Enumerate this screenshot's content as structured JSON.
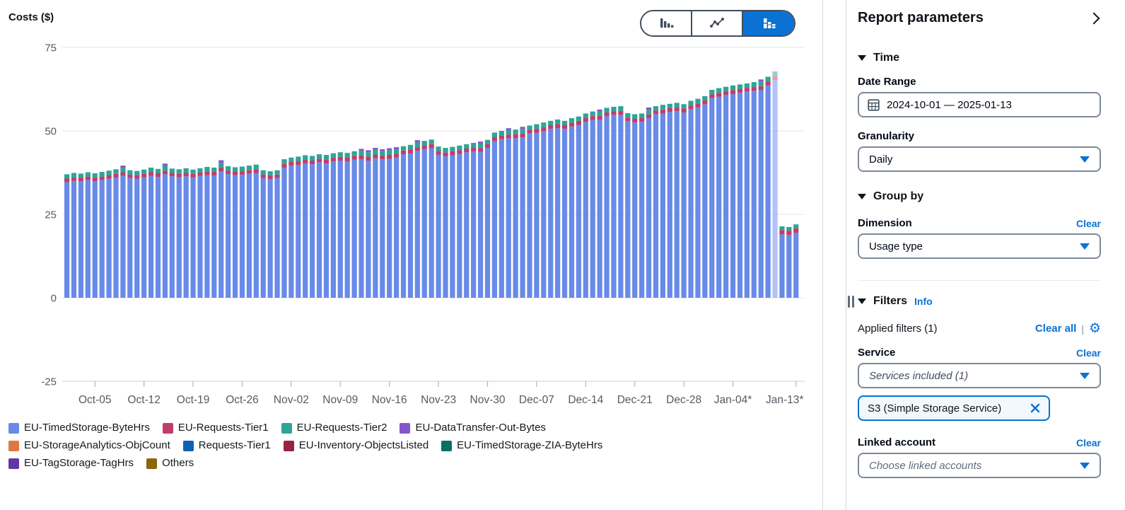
{
  "chart": {
    "title": "Costs ($)",
    "toggle_options": [
      {
        "name": "bar-chart",
        "selected": false
      },
      {
        "name": "line-chart",
        "selected": false
      },
      {
        "name": "stacked-bar-chart",
        "selected": true
      }
    ]
  },
  "legend": {
    "items": [
      {
        "label": "EU-TimedStorage-ByteHrs",
        "color": "#688AE8"
      },
      {
        "label": "EU-Requests-Tier1",
        "color": "#C33D69"
      },
      {
        "label": "EU-Requests-Tier2",
        "color": "#2EA597"
      },
      {
        "label": "EU-DataTransfer-Out-Bytes",
        "color": "#8456CE"
      },
      {
        "label": "EU-StorageAnalytics-ObjCount",
        "color": "#E07941"
      },
      {
        "label": "Requests-Tier1",
        "color": "#0D63B0"
      },
      {
        "label": "EU-Inventory-ObjectsListed",
        "color": "#962249"
      },
      {
        "label": "EU-TimedStorage-ZIA-ByteHrs",
        "color": "#096F64"
      },
      {
        "label": "EU-TagStorage-TagHrs",
        "color": "#6237A7"
      },
      {
        "label": "Others",
        "color": "#8D6605"
      }
    ]
  },
  "chart_data": {
    "type": "bar",
    "stacked": true,
    "title": "Costs ($)",
    "ylabel": "Costs ($)",
    "ylim": [
      -25,
      75
    ],
    "yticks": [
      75,
      50,
      25,
      0,
      -25
    ],
    "grid": true,
    "legend_position": "bottom",
    "xticks": [
      {
        "label": "Oct-05",
        "day": 4
      },
      {
        "label": "Oct-12",
        "day": 11
      },
      {
        "label": "Oct-19",
        "day": 18
      },
      {
        "label": "Oct-26",
        "day": 25
      },
      {
        "label": "Nov-02",
        "day": 32
      },
      {
        "label": "Nov-09",
        "day": 39
      },
      {
        "label": "Nov-16",
        "day": 46
      },
      {
        "label": "Nov-23",
        "day": 53
      },
      {
        "label": "Nov-30",
        "day": 60
      },
      {
        "label": "Dec-07",
        "day": 67
      },
      {
        "label": "Dec-14",
        "day": 74
      },
      {
        "label": "Dec-21",
        "day": 81
      },
      {
        "label": "Dec-28",
        "day": 88
      },
      {
        "label": "Jan-04*",
        "day": 95
      },
      {
        "label": "Jan-13*",
        "day": 104
      }
    ],
    "stack_order": [
      "EU-TimedStorage-ByteHrs",
      "EU-Requests-Tier1",
      "EU-Requests-Tier2",
      "EU-DataTransfer-Out-Bytes"
    ],
    "colors": {
      "EU-TimedStorage-ByteHrs": "#688AE8",
      "EU-Requests-Tier1": "#C33D69",
      "EU-Requests-Tier2": "#2EA597",
      "EU-DataTransfer-Out-Bytes": "#8456CE"
    },
    "columns": [
      "date",
      "total",
      "EU-Requests-Tier1",
      "EU-Requests-Tier2",
      "EU-DataTransfer-Out-Bytes",
      "faded"
    ],
    "note": "EU-TimedStorage-ByteHrs = total minus the other segments",
    "days": [
      [
        "2024-10-01",
        37.0,
        1.1,
        1.3,
        0
      ],
      [
        "2024-10-02",
        37.4,
        1.0,
        1.4,
        0
      ],
      [
        "2024-10-03",
        37.2,
        1.1,
        1.2,
        0
      ],
      [
        "2024-10-04",
        37.6,
        1.0,
        1.3,
        0
      ],
      [
        "2024-10-05",
        37.3,
        1.1,
        1.3,
        0
      ],
      [
        "2024-10-06",
        37.7,
        1.0,
        1.4,
        0
      ],
      [
        "2024-10-07",
        38.1,
        1.1,
        1.3,
        0
      ],
      [
        "2024-10-08",
        38.5,
        1.1,
        1.4,
        0
      ],
      [
        "2024-10-09",
        39.6,
        1.1,
        1.3,
        0.7
      ],
      [
        "2024-10-10",
        38.2,
        1.0,
        1.3,
        0
      ],
      [
        "2024-10-11",
        38.0,
        1.1,
        1.2,
        0
      ],
      [
        "2024-10-12",
        38.4,
        1.0,
        1.3,
        0
      ],
      [
        "2024-10-13",
        39.0,
        1.1,
        1.4,
        0
      ],
      [
        "2024-10-14",
        38.6,
        1.1,
        1.3,
        0
      ],
      [
        "2024-10-15",
        40.2,
        1.1,
        1.4,
        0.7
      ],
      [
        "2024-10-16",
        38.7,
        1.0,
        1.3,
        0
      ],
      [
        "2024-10-17",
        38.5,
        1.1,
        1.3,
        0
      ],
      [
        "2024-10-18",
        38.8,
        1.0,
        1.4,
        0
      ],
      [
        "2024-10-19",
        38.4,
        1.1,
        1.3,
        0
      ],
      [
        "2024-10-20",
        38.8,
        1.0,
        1.3,
        0
      ],
      [
        "2024-10-21",
        39.2,
        1.1,
        1.4,
        0
      ],
      [
        "2024-10-22",
        39.0,
        1.1,
        1.3,
        0
      ],
      [
        "2024-10-23",
        41.2,
        1.1,
        1.4,
        0.8
      ],
      [
        "2024-10-24",
        39.4,
        1.0,
        1.3,
        0
      ],
      [
        "2024-10-25",
        39.1,
        1.1,
        1.3,
        0
      ],
      [
        "2024-10-26",
        39.3,
        1.0,
        1.4,
        0
      ],
      [
        "2024-10-27",
        39.6,
        1.1,
        1.3,
        0
      ],
      [
        "2024-10-28",
        39.9,
        1.1,
        1.4,
        0
      ],
      [
        "2024-10-29",
        38.2,
        1.0,
        1.3,
        0
      ],
      [
        "2024-10-30",
        37.9,
        1.1,
        1.2,
        0
      ],
      [
        "2024-10-31",
        38.2,
        1.0,
        1.3,
        0
      ],
      [
        "2024-11-01",
        41.5,
        1.1,
        1.4,
        0
      ],
      [
        "2024-11-02",
        42.0,
        1.1,
        1.3,
        0
      ],
      [
        "2024-11-03",
        42.3,
        1.1,
        1.4,
        0
      ],
      [
        "2024-11-04",
        42.7,
        1.2,
        1.3,
        0
      ],
      [
        "2024-11-05",
        42.5,
        1.1,
        1.4,
        0
      ],
      [
        "2024-11-06",
        43.0,
        1.1,
        1.3,
        0
      ],
      [
        "2024-11-07",
        42.8,
        1.2,
        1.4,
        0
      ],
      [
        "2024-11-08",
        43.3,
        1.1,
        1.3,
        0
      ],
      [
        "2024-11-09",
        43.6,
        1.1,
        1.4,
        0
      ],
      [
        "2024-11-10",
        43.4,
        1.2,
        1.3,
        0
      ],
      [
        "2024-11-11",
        43.9,
        1.1,
        1.4,
        0
      ],
      [
        "2024-11-12",
        44.6,
        1.1,
        1.4,
        0.6
      ],
      [
        "2024-11-13",
        44.2,
        1.2,
        1.3,
        0.6
      ],
      [
        "2024-11-14",
        44.9,
        1.1,
        1.4,
        0.6
      ],
      [
        "2024-11-15",
        44.5,
        1.1,
        1.3,
        0.6
      ],
      [
        "2024-11-16",
        44.8,
        1.2,
        1.4,
        0.6
      ],
      [
        "2024-11-17",
        45.1,
        1.1,
        1.4,
        0.6
      ],
      [
        "2024-11-18",
        45.4,
        1.1,
        1.3,
        0
      ],
      [
        "2024-11-19",
        45.8,
        1.2,
        1.4,
        0
      ],
      [
        "2024-11-20",
        47.2,
        1.1,
        1.4,
        0.7
      ],
      [
        "2024-11-21",
        47.0,
        1.1,
        1.3,
        0
      ],
      [
        "2024-11-22",
        47.4,
        1.2,
        1.4,
        0
      ],
      [
        "2024-11-23",
        45.3,
        1.1,
        1.3,
        0
      ],
      [
        "2024-11-24",
        44.9,
        1.1,
        1.4,
        0
      ],
      [
        "2024-11-25",
        45.2,
        1.2,
        1.3,
        0
      ],
      [
        "2024-11-26",
        45.6,
        1.1,
        1.4,
        0
      ],
      [
        "2024-11-27",
        46.0,
        1.1,
        1.3,
        0
      ],
      [
        "2024-11-28",
        46.4,
        1.2,
        1.4,
        0
      ],
      [
        "2024-11-29",
        46.8,
        1.1,
        1.4,
        0.6
      ],
      [
        "2024-11-30",
        47.3,
        1.1,
        1.3,
        0
      ],
      [
        "2024-12-01",
        49.5,
        1.2,
        1.4,
        0
      ],
      [
        "2024-12-02",
        50.0,
        1.1,
        1.4,
        0
      ],
      [
        "2024-12-03",
        50.8,
        1.1,
        1.3,
        0.6
      ],
      [
        "2024-12-04",
        50.4,
        1.2,
        1.4,
        0
      ],
      [
        "2024-12-05",
        51.2,
        1.1,
        1.4,
        0.6
      ],
      [
        "2024-12-06",
        51.6,
        1.1,
        1.3,
        0
      ],
      [
        "2024-12-07",
        52.0,
        1.2,
        1.4,
        0
      ],
      [
        "2024-12-08",
        52.5,
        1.1,
        1.4,
        0
      ],
      [
        "2024-12-09",
        53.0,
        1.1,
        1.3,
        0
      ],
      [
        "2024-12-10",
        53.4,
        1.2,
        1.4,
        0
      ],
      [
        "2024-12-11",
        53.0,
        1.1,
        1.3,
        0
      ],
      [
        "2024-12-12",
        53.8,
        1.1,
        1.4,
        0
      ],
      [
        "2024-12-13",
        54.3,
        1.2,
        1.3,
        0
      ],
      [
        "2024-12-14",
        55.2,
        1.1,
        1.4,
        0
      ],
      [
        "2024-12-15",
        55.8,
        1.1,
        1.4,
        0
      ],
      [
        "2024-12-16",
        56.4,
        1.2,
        1.3,
        0.6
      ],
      [
        "2024-12-17",
        56.9,
        1.1,
        1.4,
        0
      ],
      [
        "2024-12-18",
        57.2,
        1.1,
        1.3,
        0
      ],
      [
        "2024-12-19",
        57.4,
        1.2,
        1.4,
        0
      ],
      [
        "2024-12-20",
        55.3,
        1.1,
        1.3,
        0
      ],
      [
        "2024-12-21",
        55.0,
        1.1,
        1.4,
        0
      ],
      [
        "2024-12-22",
        55.2,
        1.2,
        1.3,
        0
      ],
      [
        "2024-12-23",
        57.0,
        1.1,
        1.4,
        0.7
      ],
      [
        "2024-12-24",
        57.4,
        1.1,
        1.3,
        0
      ],
      [
        "2024-12-25",
        57.8,
        1.2,
        1.4,
        0
      ],
      [
        "2024-12-26",
        58.1,
        1.1,
        1.3,
        0
      ],
      [
        "2024-12-27",
        58.4,
        1.1,
        1.4,
        0
      ],
      [
        "2024-12-28",
        58.0,
        1.2,
        1.3,
        0
      ],
      [
        "2024-12-29",
        59.0,
        1.1,
        1.4,
        0
      ],
      [
        "2024-12-30",
        59.6,
        1.1,
        1.4,
        0
      ],
      [
        "2024-12-31",
        60.4,
        1.2,
        1.3,
        0
      ],
      [
        "2025-01-01",
        62.3,
        1.1,
        1.4,
        0
      ],
      [
        "2025-01-02",
        62.8,
        1.2,
        1.4,
        0
      ],
      [
        "2025-01-03",
        63.2,
        1.1,
        1.3,
        0
      ],
      [
        "2025-01-04",
        63.6,
        1.2,
        1.4,
        0
      ],
      [
        "2025-01-05",
        63.9,
        1.1,
        1.4,
        0
      ],
      [
        "2025-01-06",
        64.2,
        1.1,
        1.3,
        0
      ],
      [
        "2025-01-07",
        64.6,
        1.2,
        1.4,
        0
      ],
      [
        "2025-01-08",
        65.4,
        1.1,
        1.4,
        0.6
      ],
      [
        "2025-01-09",
        66.2,
        1.2,
        1.4,
        0
      ],
      [
        "2025-01-10",
        67.8,
        1.2,
        1.4,
        0,
        1
      ],
      [
        "2025-01-11",
        21.4,
        1.3,
        1.1,
        0
      ],
      [
        "2025-01-12",
        21.2,
        1.3,
        1.1,
        0
      ],
      [
        "2025-01-13",
        22.0,
        1.3,
        1.2,
        0
      ]
    ]
  },
  "sidebar": {
    "title": "Report parameters",
    "time": {
      "heading": "Time",
      "date_range_label": "Date Range",
      "date_range_value": "2024-10-01 — 2025-01-13",
      "granularity_label": "Granularity",
      "granularity_value": "Daily"
    },
    "group_by": {
      "heading": "Group by",
      "dimension_label": "Dimension",
      "clear_label": "Clear",
      "dimension_value": "Usage type"
    },
    "filters": {
      "heading": "Filters",
      "info_label": "Info",
      "applied_label": "Applied filters (1)",
      "clear_all_label": "Clear all",
      "pipe": "|",
      "service_label": "Service",
      "service_clear_label": "Clear",
      "service_value": "Services included (1)",
      "service_token": "S3 (Simple Storage Service)",
      "linked_account_label": "Linked account",
      "linked_account_clear_label": "Clear",
      "linked_account_placeholder": "Choose linked accounts"
    }
  }
}
